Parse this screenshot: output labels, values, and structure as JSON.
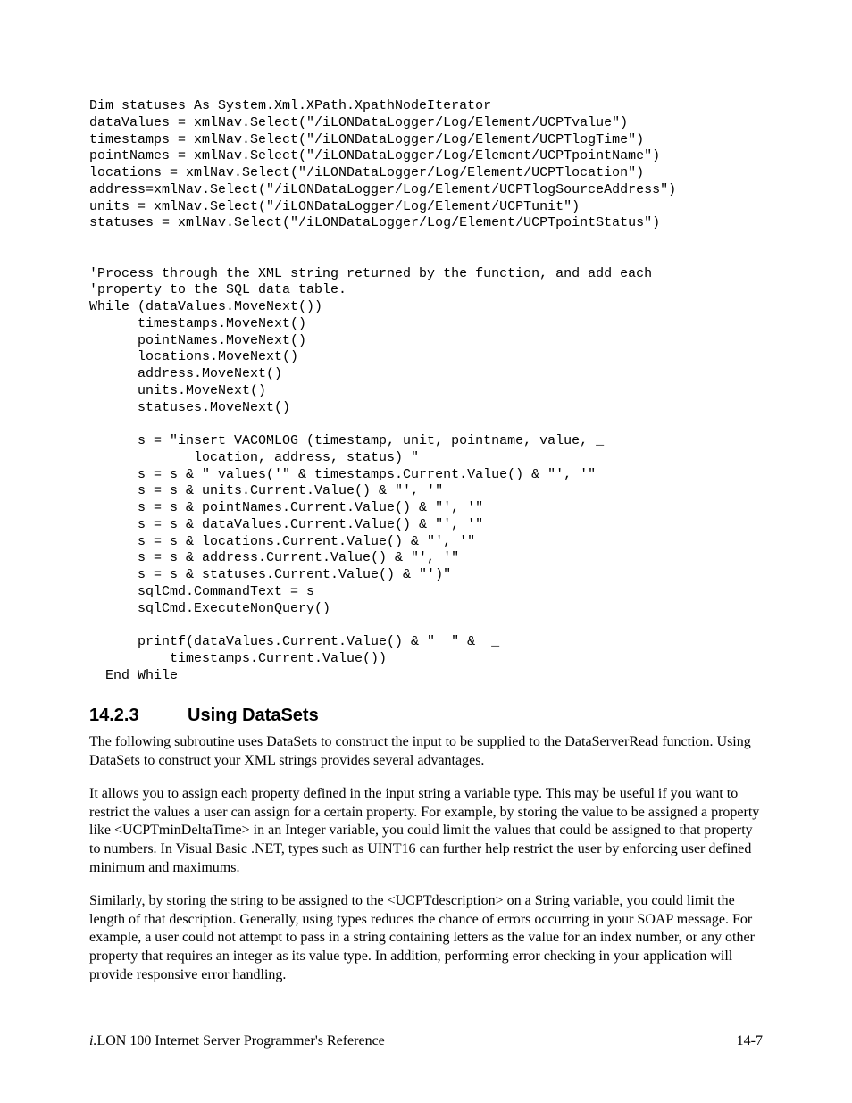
{
  "code": "Dim statuses As System.Xml.XPath.XpathNodeIterator\ndataValues = xmlNav.Select(\"/iLONDataLogger/Log/Element/UCPTvalue\")\ntimestamps = xmlNav.Select(\"/iLONDataLogger/Log/Element/UCPTlogTime\")\npointNames = xmlNav.Select(\"/iLONDataLogger/Log/Element/UCPTpointName\")\nlocations = xmlNav.Select(\"/iLONDataLogger/Log/Element/UCPTlocation\")\naddress=xmlNav.Select(\"/iLONDataLogger/Log/Element/UCPTlogSourceAddress\")\nunits = xmlNav.Select(\"/iLONDataLogger/Log/Element/UCPTunit\")\nstatuses = xmlNav.Select(\"/iLONDataLogger/Log/Element/UCPTpointStatus\")\n\n\n'Process through the XML string returned by the function, and add each\n'property to the SQL data table.\nWhile (dataValues.MoveNext())\n      timestamps.MoveNext()\n      pointNames.MoveNext()\n      locations.MoveNext()\n      address.MoveNext()\n      units.MoveNext()\n      statuses.MoveNext()\n\n      s = \"insert VACOMLOG (timestamp, unit, pointname, value, _\n             location, address, status) \"\n      s = s & \" values('\" & timestamps.Current.Value() & \"', '\"\n      s = s & units.Current.Value() & \"', '\"\n      s = s & pointNames.Current.Value() & \"', '\"\n      s = s & dataValues.Current.Value() & \"', '\"\n      s = s & locations.Current.Value() & \"', '\"\n      s = s & address.Current.Value() & \"', '\"\n      s = s & statuses.Current.Value() & \"')\"\n      sqlCmd.CommandText = s\n      sqlCmd.ExecuteNonQuery()\n\n      printf(dataValues.Current.Value() & \"  \" &  _\n          timestamps.Current.Value())\n  End While",
  "heading": {
    "number": "14.2.3",
    "title": "Using DataSets"
  },
  "paragraphs": [
    "The following subroutine uses DataSets to construct the input to be supplied to the DataServerRead function. Using DataSets to construct your XML strings provides several advantages.",
    "It allows you to assign each property defined in the input string a variable type. This may be useful if you want to restrict the values a user can assign for a certain property. For example, by storing the value to be assigned a property like <UCPTminDeltaTime> in an Integer variable, you could limit the values that could be assigned to that property to numbers. In Visual Basic .NET, types such as UINT16 can further help restrict the user by enforcing user defined minimum and maximums.",
    "Similarly, by storing the string to be assigned to the <UCPTdescription> on a String variable, you could limit the length of that description. Generally, using types reduces the chance of errors occurring in your SOAP message. For example, a user could not attempt to pass in a string containing letters as the value for an index number, or any other property that requires an integer as its value type. In addition, performing error checking in your application will provide responsive error handling."
  ],
  "footer": {
    "prefix": "i.",
    "title": "LON 100 Internet Server Programmer's Reference",
    "page": "14-7"
  }
}
